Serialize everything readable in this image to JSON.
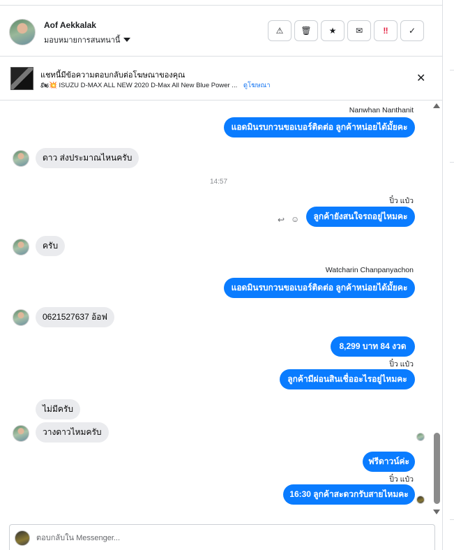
{
  "header": {
    "contact_name": "Aof Aekkalak",
    "assign_label": "มอบหมายการสนทนานี้",
    "actions": [
      {
        "name": "spam",
        "glyph": "⚠"
      },
      {
        "name": "delete",
        "glyph": "🗑"
      },
      {
        "name": "star",
        "glyph": "★"
      },
      {
        "name": "mark-unread",
        "glyph": "✉"
      },
      {
        "name": "follow-up",
        "glyph": "‼"
      },
      {
        "name": "done",
        "glyph": "✓"
      }
    ]
  },
  "ad_banner": {
    "title": "แชทนี้มีข้อความตอบกลับต่อโฆษณาของคุณ",
    "emoji": "🏍💥",
    "ad_name": "ISUZU D-MAX ALL NEW 2020 D-Max All New Blue Power ...",
    "link": "ดูโฆษณา",
    "close_glyph": "✕"
  },
  "messages": {
    "m1_sender": "Nanwhan Nanthanit",
    "m1_text": "แอดมินรบกวนขอเบอร์ติดต่อ ลูกค้าหน่อยได้มั้ยคะ",
    "m2_text": "ดาว ส่งประมาณไหนครับ",
    "time1": "14:57",
    "m3_sender": "ปิ๋ว แป๋ว",
    "m3_text": "ลูกค้ายังสนใจรถอยู่ไหมคะ",
    "m4_text": "ครับ",
    "m5_sender": "Watcharin Chanpanyachon",
    "m5_text": "แอดมินรบกวนขอเบอร์ติดต่อ ลูกค้าหน่อยได้มั้ยคะ",
    "m6_text": "0621527637 อ้อฟ",
    "m7_text": "8,299 บาท  84 งวด",
    "m8_sender": "ปิ๋ว แป๋ว",
    "m8_text": "ลูกค้ามีผ่อนสินเชื่ออะไรอยู่ไหมคะ",
    "m9_text": "ไม่มีครับ",
    "m10_text": "วางดาวไหมครับ",
    "m11_text": "ฟรีดาวน์ค่ะ",
    "m12_sender": "ปิ๋ว แป๋ว",
    "m12_text": "16:30 ลูกค้าสะดวกรับสายไหมคะ"
  },
  "composer": {
    "placeholder": "ตอบกลับใน Messenger..."
  },
  "colors": {
    "outgoing_bubble": "#0a7cff",
    "incoming_bubble": "#eaebee",
    "link": "#1877f2"
  }
}
